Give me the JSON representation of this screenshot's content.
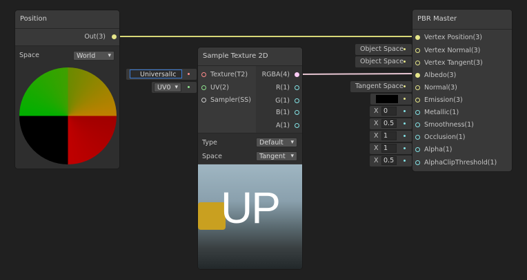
{
  "position_node": {
    "title": "Position",
    "out_label": "Out(3)",
    "space_label": "Space",
    "space_value": "World"
  },
  "sample_node": {
    "title": "Sample Texture 2D",
    "inputs": [
      "Texture(T2)",
      "UV(2)",
      "Sampler(SS)"
    ],
    "outputs": [
      "RGBA(4)",
      "R(1)",
      "G(1)",
      "B(1)",
      "A(1)"
    ],
    "type_label": "Type",
    "type_value": "Default",
    "space_label": "Space",
    "space_value": "Tangent",
    "preview_text": "UP",
    "texture_input": "UniversalIc",
    "uv_input": "UV0"
  },
  "pbr_node": {
    "title": "PBR Master",
    "ports": [
      "Vertex Position(3)",
      "Vertex Normal(3)",
      "Vertex Tangent(3)",
      "Albedo(3)",
      "Normal(3)",
      "Emission(3)",
      "Metallic(1)",
      "Smoothness(1)",
      "Occlusion(1)",
      "Alpha(1)",
      "AlphaClipThreshold(1)"
    ],
    "inputs": {
      "vertex_normal": "Object Space",
      "vertex_tangent": "Object Space",
      "normal": "Tangent Space",
      "x": "X",
      "metallic": "0",
      "smoothness": "0.5",
      "occlusion": "1",
      "alpha": "1",
      "alpha_clip": "0.5"
    }
  },
  "colors": {
    "vector3": "#e6e68a",
    "vector1": "#84e4e7",
    "texture": "#ff8b8b",
    "vector2": "#8fe58f",
    "vector4": "#fbcbf4"
  }
}
